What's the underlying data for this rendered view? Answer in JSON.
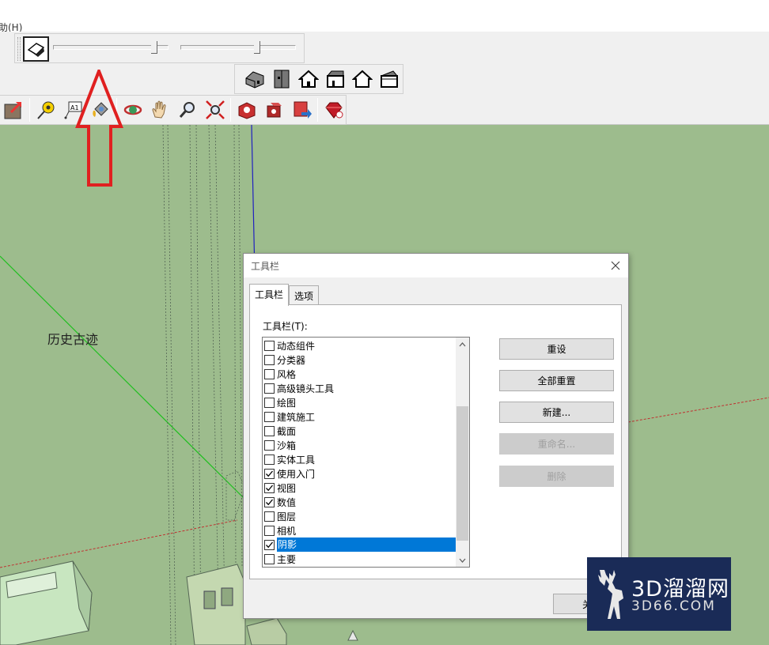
{
  "menubar": {
    "help_fragment": "助(H)"
  },
  "icons": {
    "shadow_toggle": "shadow-settings-icon",
    "views": [
      "iso-view-icon",
      "top-view-icon",
      "front-view-icon",
      "right-view-icon",
      "back-view-icon",
      "left-view-icon"
    ],
    "tools": [
      "make-component-icon",
      "tape-measure-icon",
      "text-tool-icon",
      "paint-bucket-icon",
      "orbit-icon",
      "pan-icon",
      "zoom-icon",
      "zoom-extents-icon",
      "3d-warehouse-icon",
      "share-component-icon",
      "share-model-icon",
      "ruby-extension-icon"
    ]
  },
  "scene": {
    "label": "历史古迹"
  },
  "dialog": {
    "title": "工具栏",
    "tabs": [
      {
        "label": "工具栏",
        "active": true
      },
      {
        "label": "选项",
        "active": false
      }
    ],
    "list_label": "工具栏(T):",
    "toolbars": [
      {
        "label": "动态组件",
        "checked": false,
        "selected": false
      },
      {
        "label": "分类器",
        "checked": false,
        "selected": false
      },
      {
        "label": "风格",
        "checked": false,
        "selected": false
      },
      {
        "label": "高级镜头工具",
        "checked": false,
        "selected": false
      },
      {
        "label": "绘图",
        "checked": false,
        "selected": false
      },
      {
        "label": "建筑施工",
        "checked": false,
        "selected": false
      },
      {
        "label": "截面",
        "checked": false,
        "selected": false
      },
      {
        "label": "沙箱",
        "checked": false,
        "selected": false
      },
      {
        "label": "实体工具",
        "checked": false,
        "selected": false
      },
      {
        "label": "使用入门",
        "checked": true,
        "selected": false
      },
      {
        "label": "视图",
        "checked": true,
        "selected": false
      },
      {
        "label": "数值",
        "checked": true,
        "selected": false
      },
      {
        "label": "图层",
        "checked": false,
        "selected": false
      },
      {
        "label": "相机",
        "checked": false,
        "selected": false
      },
      {
        "label": "阴影",
        "checked": true,
        "selected": true
      },
      {
        "label": "主要",
        "checked": false,
        "selected": false
      }
    ],
    "buttons": {
      "reset": "重设",
      "reset_all": "全部重置",
      "new": "新建...",
      "rename": "重命名...",
      "delete": "删除",
      "close": "关"
    }
  },
  "watermark": {
    "main": "3D溜溜网",
    "sub": "3D66.COM"
  },
  "colors": {
    "viewport": "#9dbc8d",
    "selection": "#0078d7",
    "annotation_arrow": "#e02020",
    "watermark_bg": "#1a2b57"
  }
}
